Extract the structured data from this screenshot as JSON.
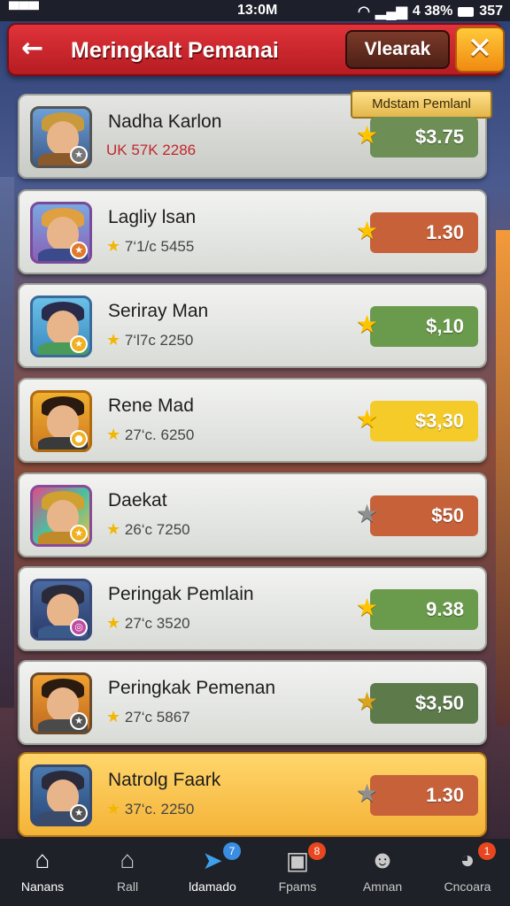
{
  "status_bar": {
    "left": "▀▀▀",
    "time": "13:0M",
    "battery": "4 38%",
    "right_extra": "357"
  },
  "header": {
    "title": "Meringkalt Pemanai",
    "action_label": "Vlearak",
    "close_label": "✕",
    "back_label": "←"
  },
  "players": [
    {
      "name": "Nadha Karlon",
      "stats": "UK 57K 2286",
      "score": "$3.75",
      "pill_color": "#6d8e55",
      "star": "gold",
      "tag": "Mdstam Pemlanl"
    },
    {
      "name": "Lagliy lsan",
      "stats": "7‘1/c 5455",
      "score": "1.30",
      "pill_color": "#c7613a",
      "star": "gold"
    },
    {
      "name": "Seriray Man",
      "stats": "7‘l7c 2250",
      "score": "$,10",
      "pill_color": "#6a9a4b",
      "star": "gold"
    },
    {
      "name": "Rene Mad",
      "stats": "27‘c. 6250",
      "score": "$3,30",
      "pill_color": "#f5cb2a",
      "star": "gold"
    },
    {
      "name": "Daekat",
      "stats": "26‘c 7250",
      "score": "$50",
      "pill_color": "#c7613a",
      "star": "grey"
    },
    {
      "name": "Peringak Pemlain",
      "stats": "27‘c 3520",
      "score": "9.38",
      "pill_color": "#6a9a4b",
      "star": "gold"
    },
    {
      "name": "Peringkak Pemenan",
      "stats": "27‘c 5867",
      "score": "$3,50",
      "pill_color": "#5c7a4a",
      "star": "gold"
    },
    {
      "name": "Natrolg Faark",
      "stats": "37‘c. 2250",
      "score": "1.30",
      "pill_color": "#c7613a",
      "star": "grey"
    }
  ],
  "nav": [
    {
      "label": "Nanans",
      "icon": "home-icon",
      "glyph": "⌂",
      "badge": ""
    },
    {
      "label": "Rall",
      "icon": "house-icon",
      "glyph": "⌂",
      "badge": ""
    },
    {
      "label": "ldamado",
      "icon": "send-icon",
      "glyph": "➤",
      "badge": "7"
    },
    {
      "label": "Fpams",
      "icon": "image-icon",
      "glyph": "▣",
      "badge": "8"
    },
    {
      "label": "Amnan",
      "icon": "face-icon",
      "glyph": "☻",
      "badge": ""
    },
    {
      "label": "Cncoara",
      "icon": "chat-icon",
      "glyph": "◕",
      "badge": "1"
    }
  ],
  "colors": {
    "header_red": "#c9262c",
    "gold_row": "#f4b338",
    "nav_bg": "#1f2128"
  }
}
